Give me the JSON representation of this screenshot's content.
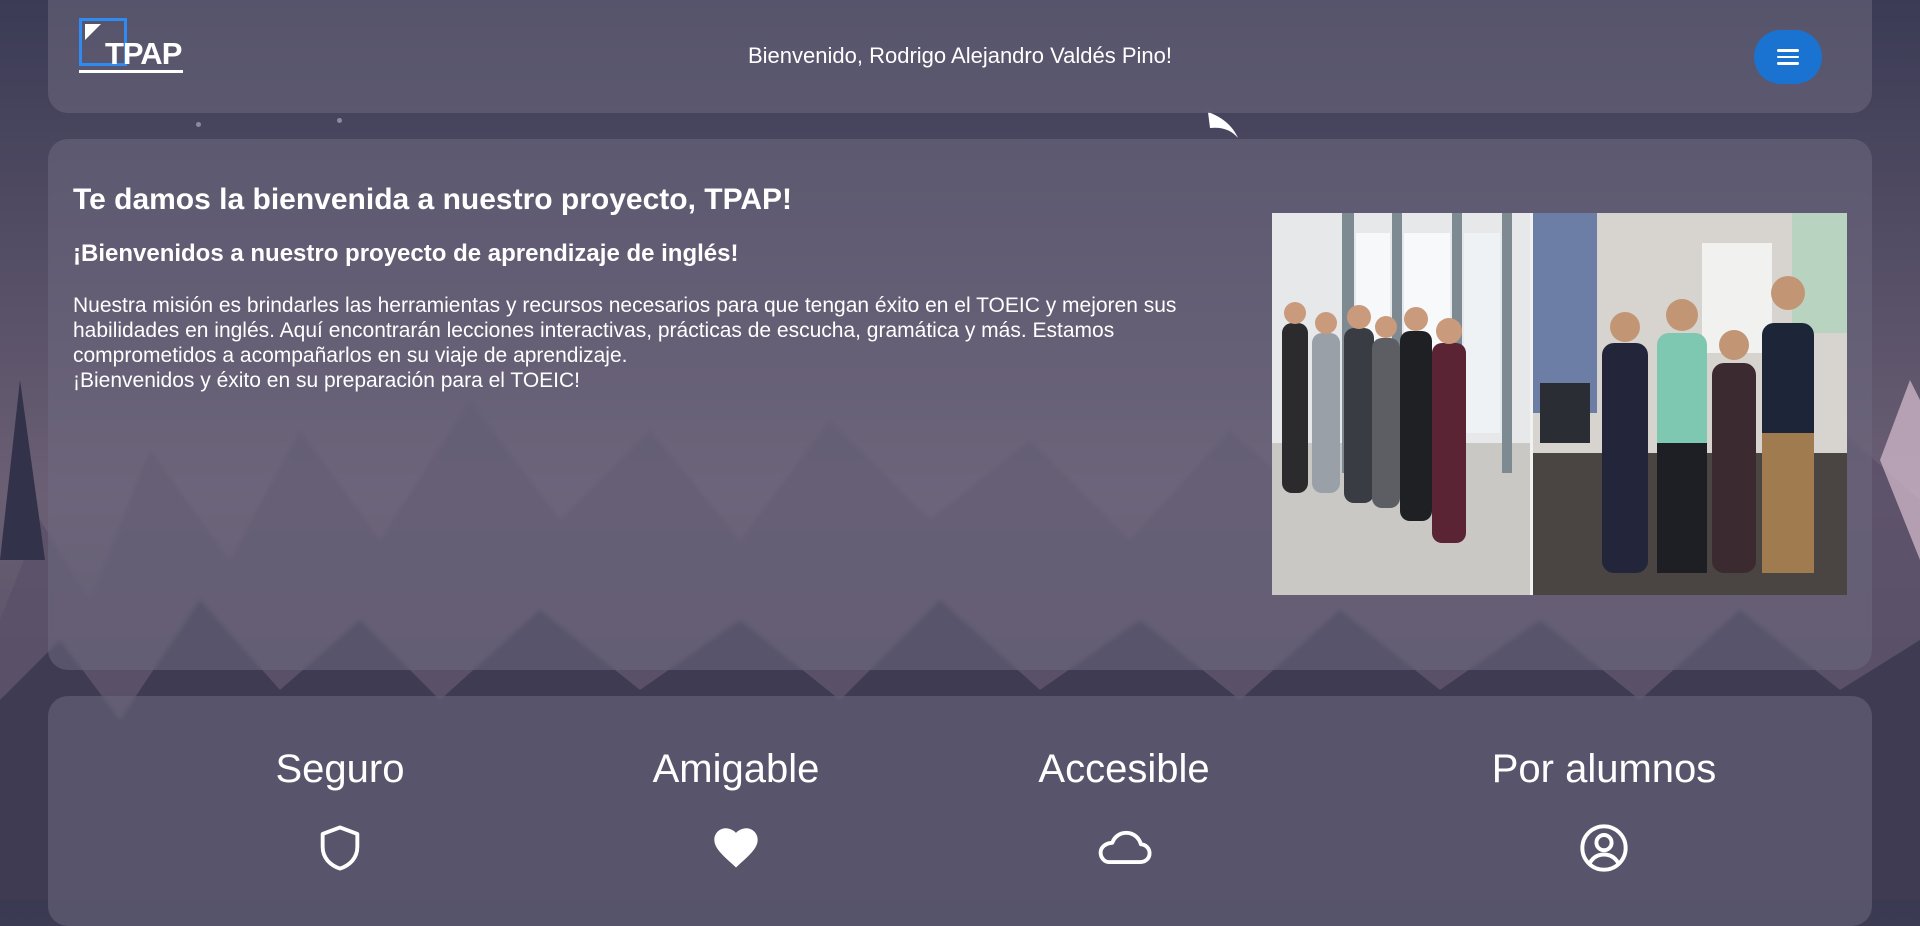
{
  "header": {
    "logo_text": "TPAP",
    "welcome": "Bienvenido, Rodrigo Alejandro Valdés Pino!",
    "menu_icon": "hamburger-icon"
  },
  "hero": {
    "title": "Te damos la bienvenida a nuestro proyecto, TPAP!",
    "subtitle": "¡Bienvenidos a nuestro proyecto de aprendizaje de inglés!",
    "paragraph": "Nuestra misión es brindarles las herramientas y recursos necesarios para que tengan éxito en el TOEIC y mejoren sus habilidades en inglés. Aquí encontrarán lecciones interactivas, prácticas de escucha, gramática y más. Estamos comprometidos a acompañarlos en su viaje de aprendizaje.",
    "closing": "¡Bienvenidos y éxito en su preparación para el TOEIC!"
  },
  "features": [
    {
      "label": "Seguro",
      "icon": "shield-icon"
    },
    {
      "label": "Amigable",
      "icon": "heart-icon"
    },
    {
      "label": "Accesible",
      "icon": "cloud-icon"
    },
    {
      "label": "Por alumnos",
      "icon": "user-circle-icon"
    }
  ],
  "colors": {
    "accent": "#1a73d0",
    "logo_blue": "#2f8af2"
  }
}
